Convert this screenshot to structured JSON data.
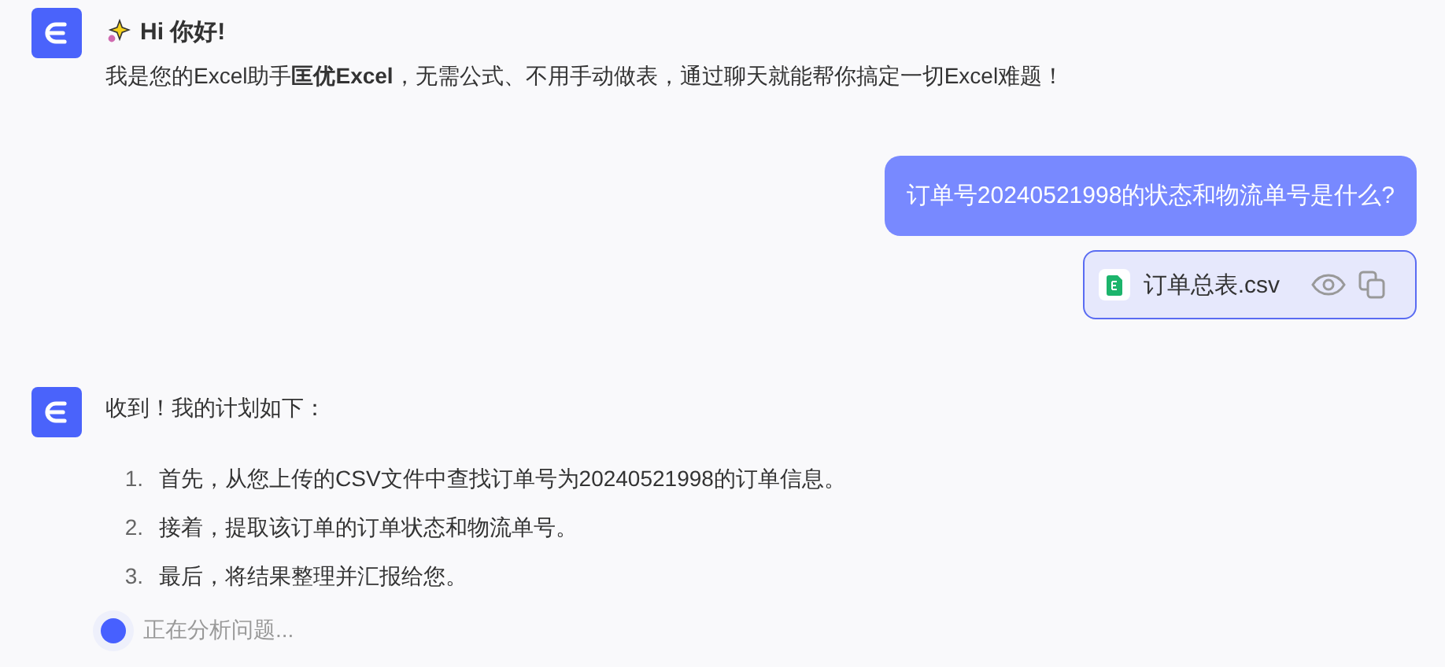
{
  "messages": [
    {
      "kind": "assistant",
      "title": "Hi 你好!",
      "text": "我是您的Excel助手**匡优Excel**，无需公式、不用手动做表，通过聊天就能帮你搞定一切Excel难题！"
    },
    {
      "kind": "user",
      "text": "订单号20240521998的状态和物流单号是什么?",
      "attachment": {
        "file_name": "订单总表.csv"
      }
    },
    {
      "kind": "assistant",
      "text": "收到！我的计划如下：",
      "steps": [
        {
          "number": "1.",
          "text": "首先，从您上传的CSV文件中查找订单号为20240521998的订单信息。"
        },
        {
          "number": "2.",
          "text": "接着，提取该订单的订单状态和物流单号。"
        },
        {
          "number": "3.",
          "text": "最后，将结果整理并汇报给您。"
        }
      ],
      "status": "正在分析问题..."
    }
  ]
}
